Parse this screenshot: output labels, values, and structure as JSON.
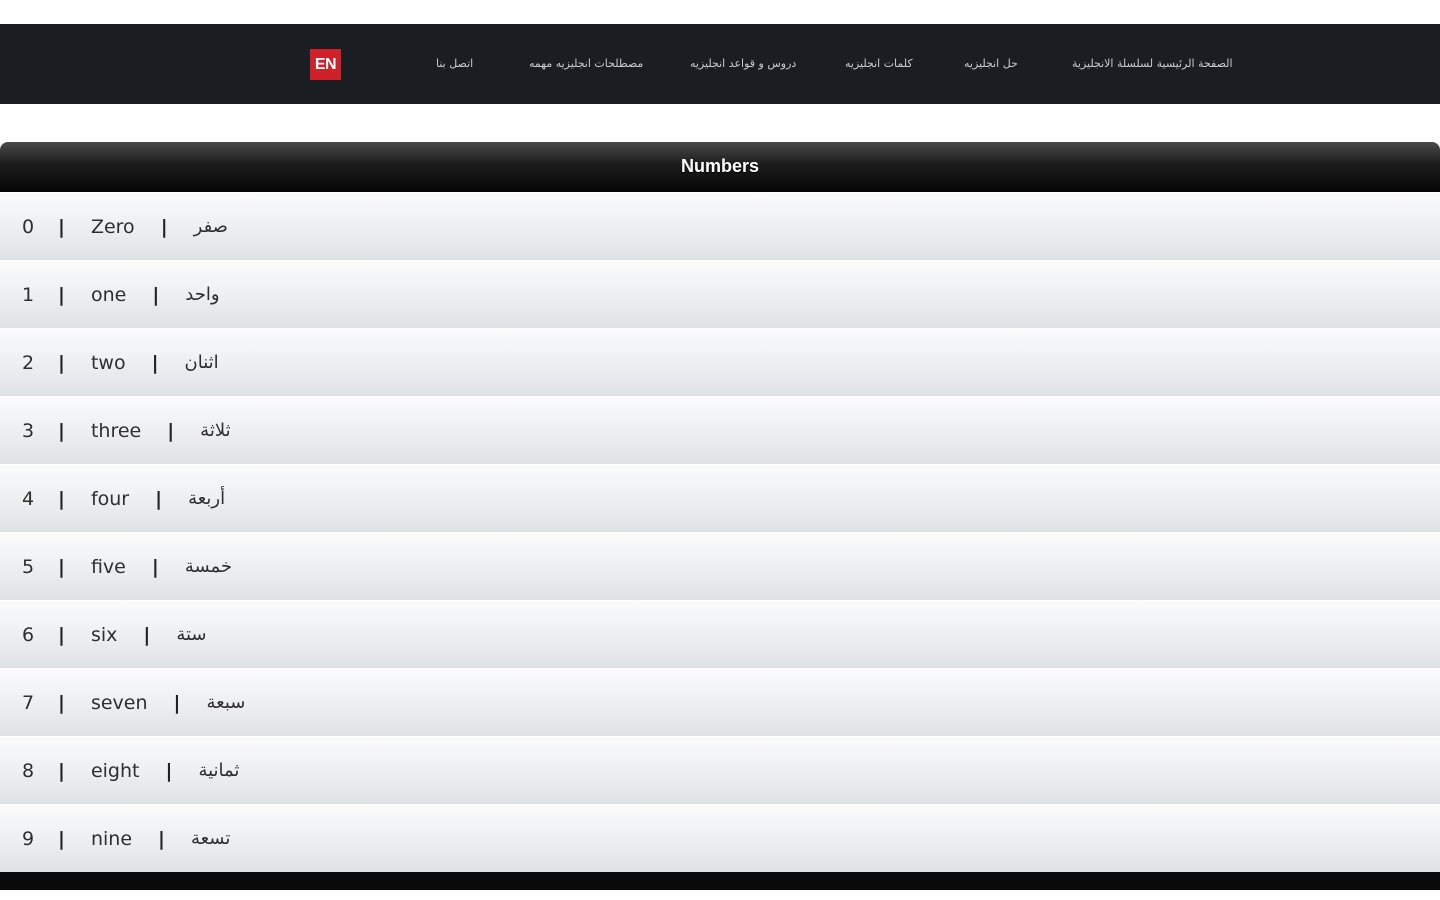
{
  "logo": {
    "text": "EN"
  },
  "nav": {
    "items": [
      {
        "label": "الصفحة الرئيسية لسلسلة الانجليزية"
      },
      {
        "label": "حل انجليزيه"
      },
      {
        "label": "كلمات انجليزيه"
      },
      {
        "label": "دروس و قواعد انجليزيه"
      },
      {
        "label": "مصطلحات انجليزيه مهمه"
      },
      {
        "label": "اتصل بنا"
      }
    ]
  },
  "section": {
    "title": "Numbers"
  },
  "numbers": [
    {
      "digit": "0",
      "english": "Zero",
      "arabic": "صفر"
    },
    {
      "digit": "1",
      "english": "one",
      "arabic": "واحد"
    },
    {
      "digit": "2",
      "english": "two",
      "arabic": "اثنان"
    },
    {
      "digit": "3",
      "english": "three",
      "arabic": "ثلاثة"
    },
    {
      "digit": "4",
      "english": "four",
      "arabic": "أربعة"
    },
    {
      "digit": "5",
      "english": "five",
      "arabic": "خمسة"
    },
    {
      "digit": "6",
      "english": "six",
      "arabic": "ستة"
    },
    {
      "digit": "7",
      "english": "seven",
      "arabic": "سبعة"
    },
    {
      "digit": "8",
      "english": "eight",
      "arabic": "ثمانية"
    },
    {
      "digit": "9",
      "english": "nine",
      "arabic": "تسعة"
    }
  ],
  "separator": "|"
}
